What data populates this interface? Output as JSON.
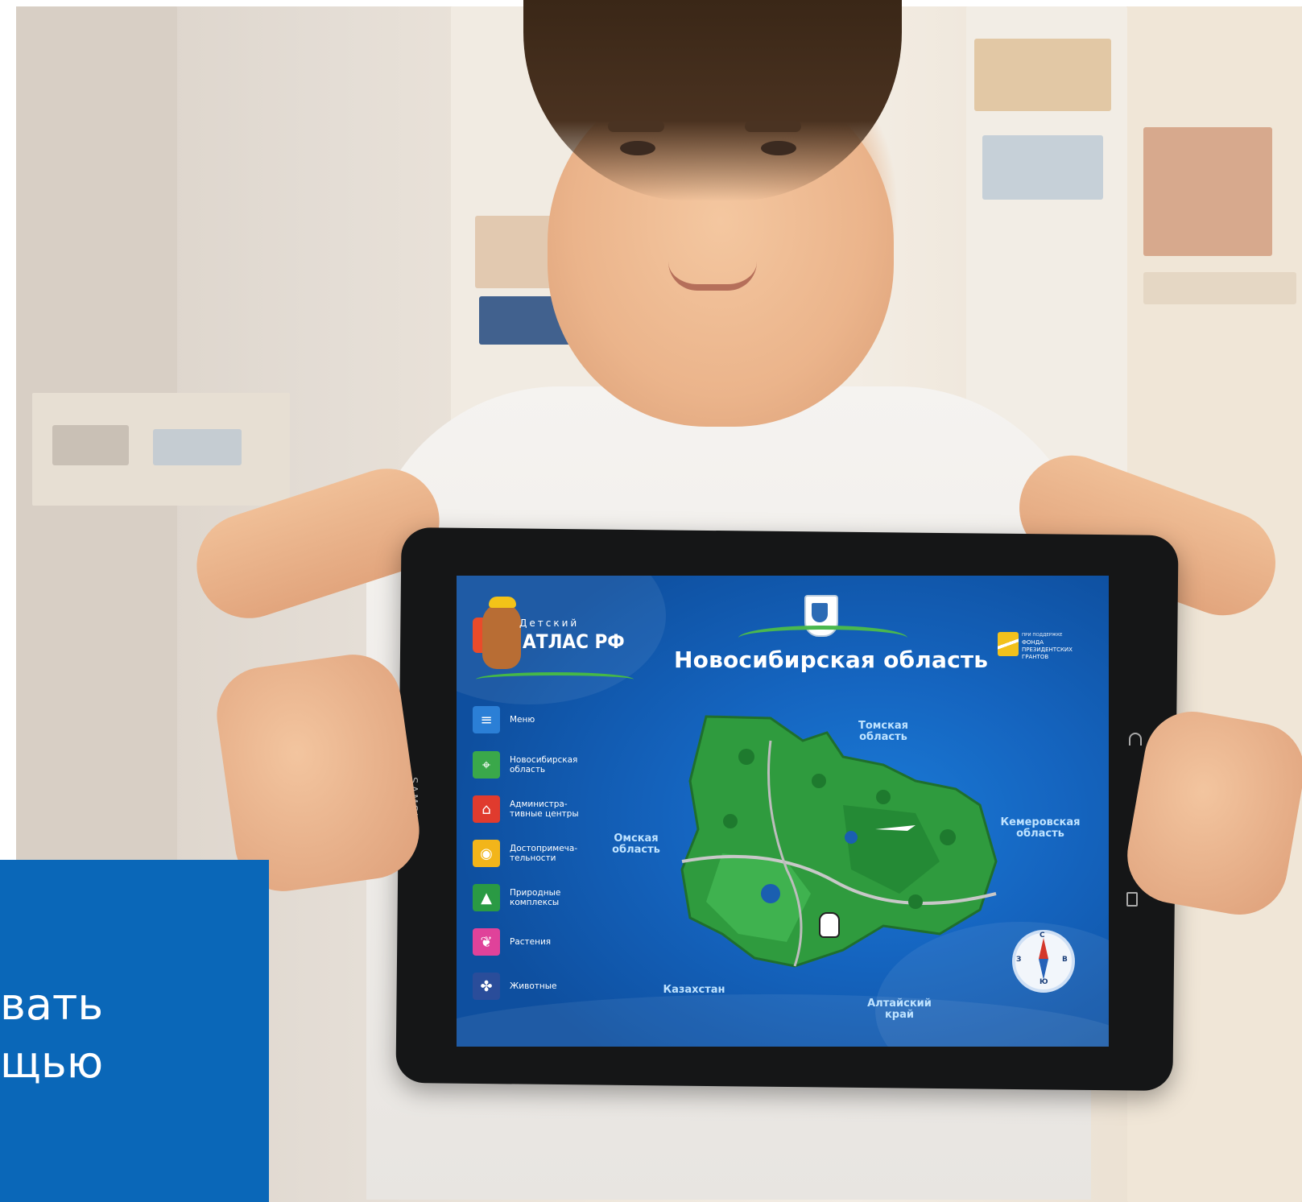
{
  "tablet": {
    "brand": "SAMSUNG",
    "app": {
      "logo": {
        "small": "Детский",
        "title": "АТЛАС РФ"
      },
      "region_title": "Новосибирская область",
      "grant": {
        "line1": "ПРИ ПОДДЕРЖКЕ",
        "line2": "ФОНДА",
        "line3": "ПРЕЗИДЕНТСКИХ",
        "line4": "ГРАНТОВ"
      },
      "menu": [
        {
          "label": "Меню",
          "icon": "menu-icon",
          "color": "#2b7fd6"
        },
        {
          "label": "Новосибирская область",
          "icon": "map-pin-icon",
          "color": "#3aa84a"
        },
        {
          "label": "Администра-тивные центры",
          "icon": "home-icon",
          "color": "#e03b2e"
        },
        {
          "label": "Достопримеча-тельности",
          "icon": "camera-icon",
          "color": "#f2b51a"
        },
        {
          "label": "Природные комплексы",
          "icon": "tree-icon",
          "color": "#2a9a44"
        },
        {
          "label": "Растения",
          "icon": "leaf-icon",
          "color": "#e0429a"
        },
        {
          "label": "Животные",
          "icon": "paw-icon",
          "color": "#2a4d9a"
        }
      ],
      "neighbors": {
        "tomsk": "Томская область",
        "kemerovo": "Кемеровская область",
        "omsk": "Омская область",
        "kazakhstan": "Казахстан",
        "altai": "Алтайский край"
      },
      "compass": {
        "n": "С",
        "s": "Ю",
        "w": "З",
        "e": "В"
      }
    }
  },
  "overlay": {
    "line1": "вать",
    "line2": "щью",
    "color": "#0a67b8"
  }
}
